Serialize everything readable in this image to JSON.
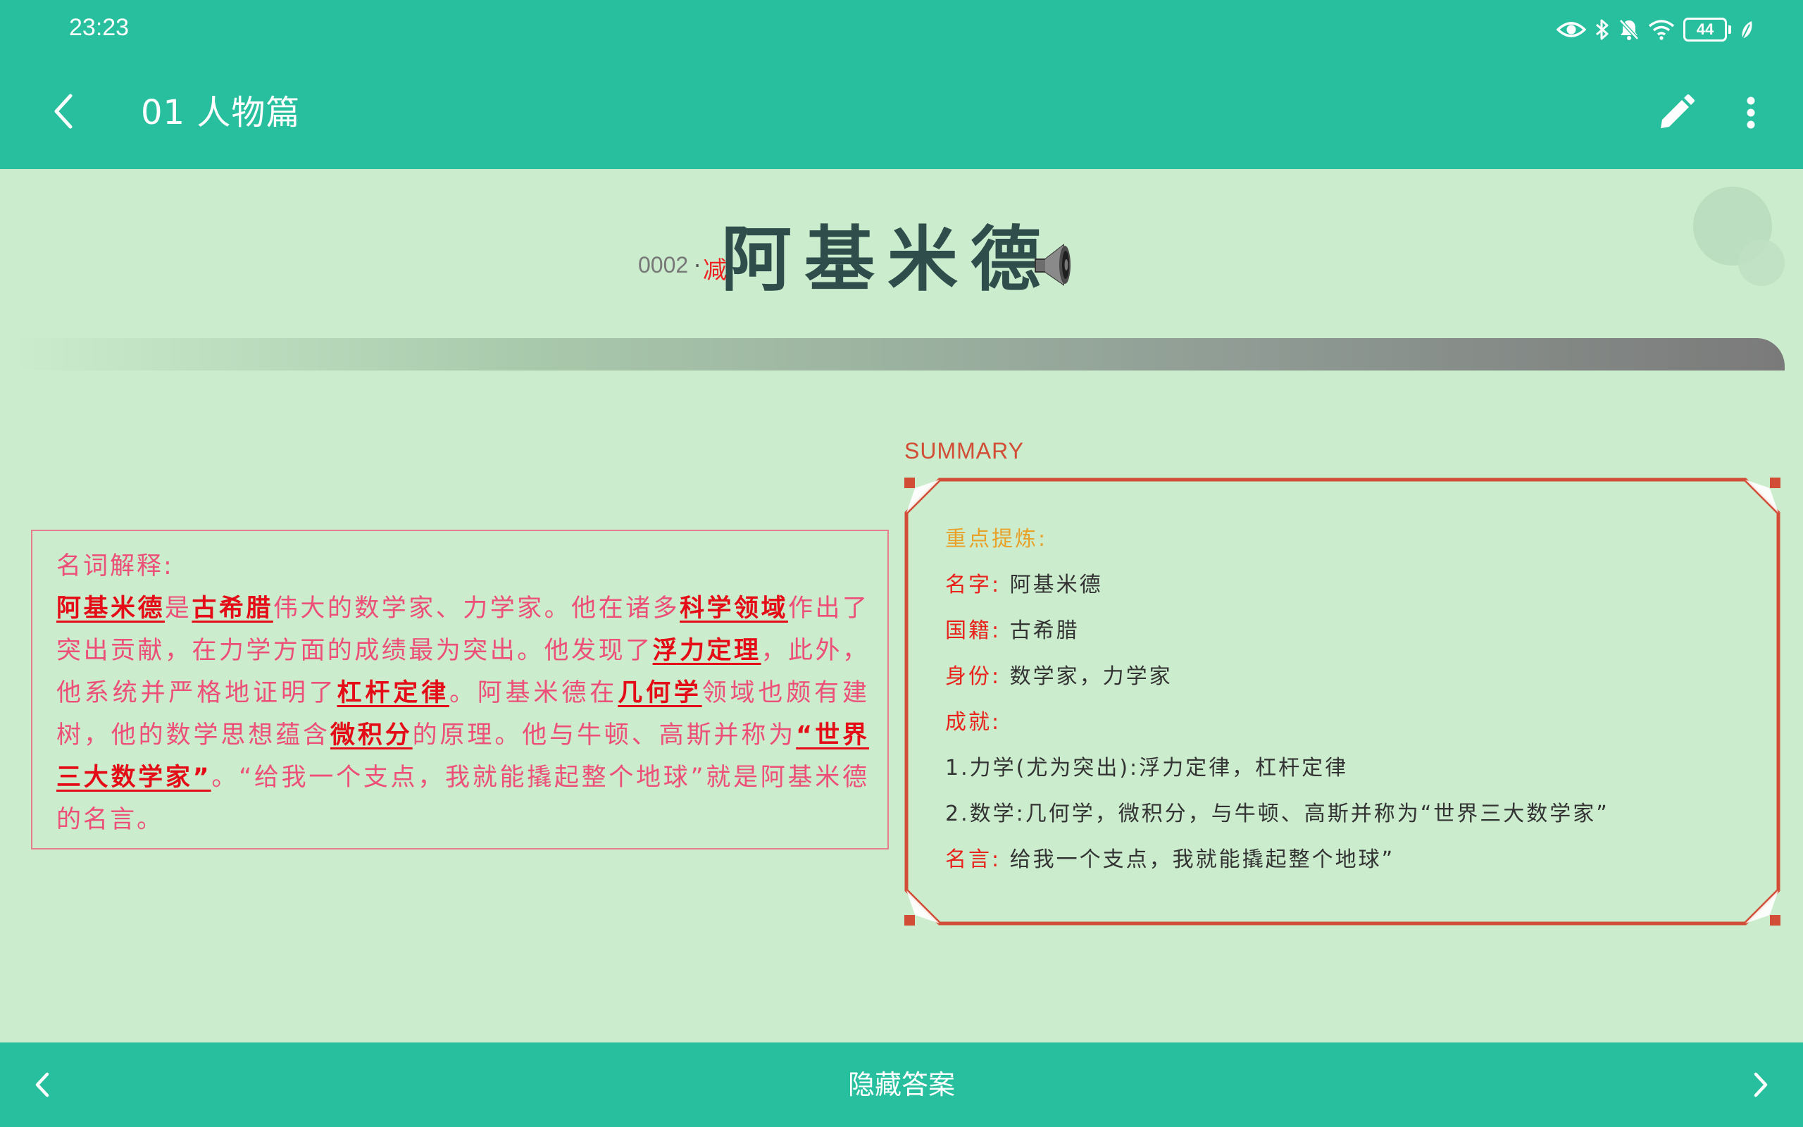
{
  "status_bar": {
    "time": "23:23",
    "battery": "44",
    "icons": [
      "eye-icon",
      "bluetooth-icon",
      "bell-off-icon",
      "wifi-icon",
      "battery-icon",
      "leaf-icon"
    ]
  },
  "app_bar": {
    "title": "01 人物篇",
    "back_icon": "chevron-left-icon",
    "edit_icon": "pencil-icon",
    "more_icon": "more-vertical-icon"
  },
  "card": {
    "number": "0002",
    "separator": "·",
    "tag": "减",
    "headword": "阿基米德",
    "audio_icon": "speaker-icon"
  },
  "definition": {
    "heading": "名词解释:",
    "segments": [
      {
        "text": "阿基米德",
        "highlight": true
      },
      {
        "text": "是",
        "highlight": false
      },
      {
        "text": "古希腊",
        "highlight": true
      },
      {
        "text": "伟大的数学家、力学家。他在诸多",
        "highlight": false
      },
      {
        "text": "科学领域",
        "highlight": true
      },
      {
        "text": "作出了突出贡献，在力学方面的成绩最为突出。他发现了",
        "highlight": false
      },
      {
        "text": "浮力定理",
        "highlight": true
      },
      {
        "text": "，此外，他系统并严格地证明了",
        "highlight": false
      },
      {
        "text": "杠杆定律",
        "highlight": true
      },
      {
        "text": "。阿基米德在",
        "highlight": false
      },
      {
        "text": "几何学",
        "highlight": true
      },
      {
        "text": "领域也颇有建树，他的数学思想蕴含",
        "highlight": false
      },
      {
        "text": "微积分",
        "highlight": true
      },
      {
        "text": "的原理。他与牛顿、高斯并称为",
        "highlight": false
      },
      {
        "text": "“世界三大数学家”",
        "highlight": true
      },
      {
        "text": "。“给我一个支点，我就能撬起整个地球”就是阿基米德的名言。",
        "highlight": false
      }
    ]
  },
  "summary": {
    "label": "SUMMARY",
    "heading": "重点提炼:",
    "name_key": "名字:",
    "name_value": "阿基米德",
    "nationality_key": "国籍:",
    "nationality_value": "古希腊",
    "identity_key": "身份:",
    "identity_value": "数学家，力学家",
    "achievement_key": "成就:",
    "achievement_1": "1.力学(尤为突出):浮力定律，杠杆定律",
    "achievement_2": "2.数学:几何学，微积分，与牛顿、高斯并称为“世界三大数学家”",
    "quote_key": "名言:",
    "quote_value": "给我一个支点，我就能撬起整个地球”"
  },
  "bottom_bar": {
    "toggle_label": "隐藏答案",
    "prev_icon": "chevron-left-icon",
    "next_icon": "chevron-right-icon"
  },
  "colors": {
    "primary": "#28bf9e",
    "background": "#cbeccd",
    "highlight": "#e40c16",
    "definition_text": "#ec4f78",
    "summary_border": "#d24d35",
    "summary_heading": "#e8a22a",
    "headword": "#2f4d4a"
  }
}
